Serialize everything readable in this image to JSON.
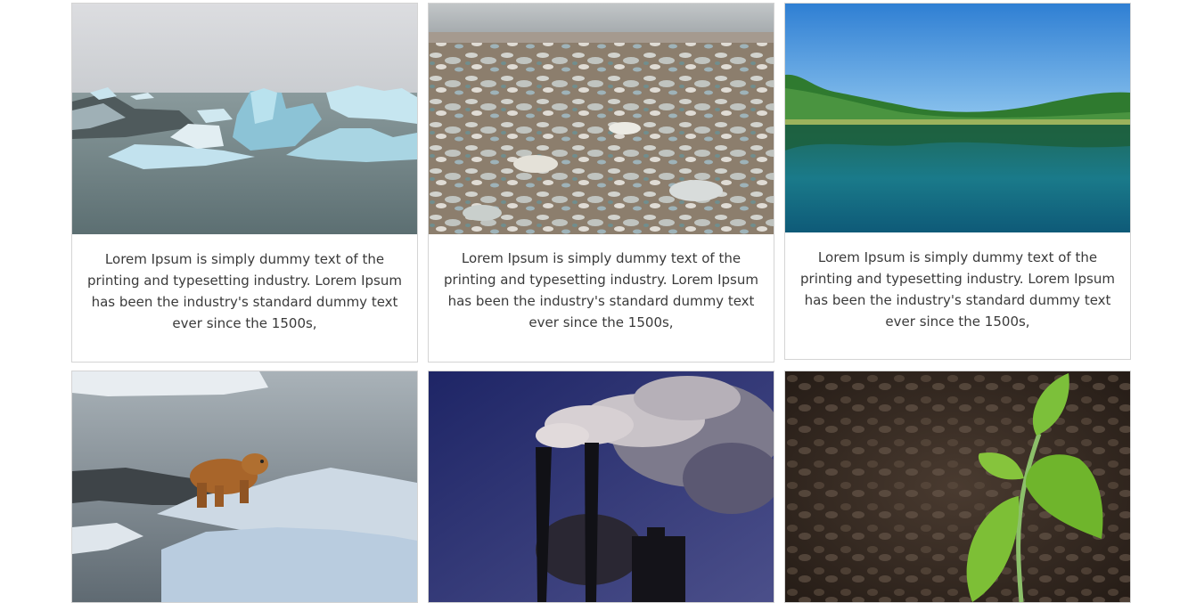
{
  "cards": [
    {
      "image": "icebergs-in-lagoon",
      "caption": "Lorem Ipsum is simply dummy text of the printing and typesetting industry. Lorem Ipsum has been the industry's standard dummy text ever since the 1500s,"
    },
    {
      "image": "plastic-waste-beach",
      "caption": "Lorem Ipsum is simply dummy text of the printing and typesetting industry. Lorem Ipsum has been the industry's standard dummy text ever since the 1500s,"
    },
    {
      "image": "clear-lake-forest",
      "caption": "Lorem Ipsum is simply dummy text of the printing and typesetting industry. Lorem Ipsum has been the industry's standard dummy text ever since the 1500s,"
    },
    {
      "image": "polar-bear-on-ice",
      "caption": ""
    },
    {
      "image": "factory-smokestacks",
      "caption": ""
    },
    {
      "image": "green-seedling-soil",
      "caption": ""
    }
  ]
}
